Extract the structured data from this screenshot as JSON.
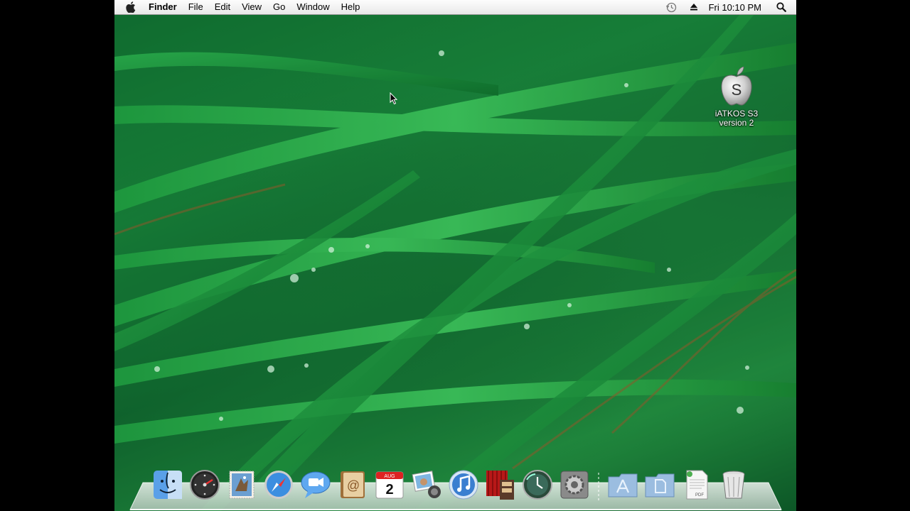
{
  "menubar": {
    "apple_icon": "apple-icon",
    "app_name": "Finder",
    "items": [
      "File",
      "Edit",
      "View",
      "Go",
      "Window",
      "Help"
    ],
    "status_icons": [
      "time-machine-icon",
      "eject-icon",
      "spotlight-icon"
    ],
    "clock": "Fri 10:10 PM"
  },
  "desktop": {
    "disk_icon_glyph": "S",
    "disk_label": "iATKOS S3\nversion 2"
  },
  "dock": {
    "calendar_month": "AUG",
    "calendar_day": "2",
    "preview_badge": "PDF",
    "apps": [
      "Finder",
      "Dashboard",
      "Mail",
      "Safari",
      "iChat",
      "Address Book",
      "iCal",
      "iPhoto",
      "iTunes",
      "Front Row",
      "Time Machine",
      "System Preferences"
    ],
    "folders": [
      "Applications",
      "Documents",
      "PDF Document",
      "Trash"
    ]
  }
}
